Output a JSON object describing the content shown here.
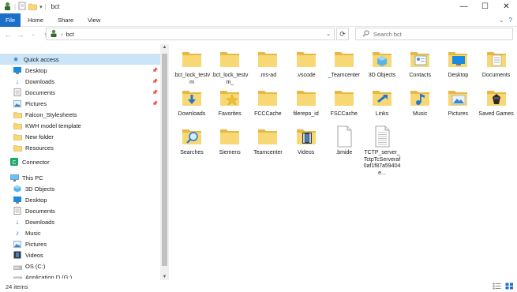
{
  "window": {
    "title": "bct",
    "controls": [
      "—",
      "☐",
      "✕"
    ]
  },
  "ribbon": {
    "tabs": [
      "File",
      "Home",
      "Share",
      "View"
    ]
  },
  "address": {
    "path": "bct"
  },
  "search": {
    "placeholder": "Search bct"
  },
  "sidebar": {
    "items": [
      {
        "label": "Quick access",
        "icon": "star-icon",
        "selected": true
      },
      {
        "label": "Desktop",
        "icon": "desktop-icon",
        "pinned": true
      },
      {
        "label": "Downloads",
        "icon": "downloads-icon",
        "pinned": true
      },
      {
        "label": "Documents",
        "icon": "documents-icon",
        "pinned": true
      },
      {
        "label": "Pictures",
        "icon": "pictures-icon",
        "pinned": true
      },
      {
        "label": "Falcon_Stylesheets",
        "icon": "folder-icon"
      },
      {
        "label": "KWH model template",
        "icon": "folder-icon"
      },
      {
        "label": "New folder",
        "icon": "folder-icon"
      },
      {
        "label": "Resources",
        "icon": "folder-icon"
      },
      {
        "label": "Connector",
        "icon": "connector-icon"
      },
      {
        "label": "This PC",
        "icon": "computer-icon"
      },
      {
        "label": "3D Objects",
        "icon": "3d-objects-icon"
      },
      {
        "label": "Desktop",
        "icon": "desktop-icon"
      },
      {
        "label": "Documents",
        "icon": "documents-icon"
      },
      {
        "label": "Downloads",
        "icon": "downloads-icon"
      },
      {
        "label": "Music",
        "icon": "music-icon"
      },
      {
        "label": "Pictures",
        "icon": "pictures-icon"
      },
      {
        "label": "Videos",
        "icon": "videos-icon"
      },
      {
        "label": "OS  (C:)",
        "icon": "drive-icon"
      },
      {
        "label": "Application D (G:)",
        "icon": "drive-icon"
      }
    ]
  },
  "files": [
    {
      "name": ".bct_lock_testvm",
      "icon": "folder"
    },
    {
      "name": ".bct_lock_testvm_",
      "icon": "folder"
    },
    {
      "name": ".ms-ad",
      "icon": "folder"
    },
    {
      "name": ".vscode",
      "icon": "folder"
    },
    {
      "name": "_Teamcenter",
      "icon": "folder"
    },
    {
      "name": "3D Objects",
      "icon": "folder-3d"
    },
    {
      "name": "Contacts",
      "icon": "folder-contacts"
    },
    {
      "name": "Desktop",
      "icon": "folder-desktop"
    },
    {
      "name": "Documents",
      "icon": "folder-documents"
    },
    {
      "name": "Downloads",
      "icon": "folder-downloads"
    },
    {
      "name": "Favorites",
      "icon": "folder-favorites"
    },
    {
      "name": "FCCCache",
      "icon": "folder"
    },
    {
      "name": "filerepo_id",
      "icon": "folder"
    },
    {
      "name": "FSCCache",
      "icon": "folder"
    },
    {
      "name": "Links",
      "icon": "folder-links"
    },
    {
      "name": "Music",
      "icon": "folder-music"
    },
    {
      "name": "Pictures",
      "icon": "folder-pictures"
    },
    {
      "name": "Saved Games",
      "icon": "folder-games"
    },
    {
      "name": "Searches",
      "icon": "folder-searches"
    },
    {
      "name": "Siemens",
      "icon": "folder"
    },
    {
      "name": "Teamcenter",
      "icon": "folder"
    },
    {
      "name": "Videos",
      "icon": "folder-videos"
    },
    {
      "name": ".bmide",
      "icon": "file"
    },
    {
      "name": "TCTP_server_TctpTcServeraf0af1f87a59404e...",
      "icon": "file-text"
    }
  ],
  "status": {
    "count": "24 items"
  },
  "colors": {
    "accent": "#1a6fc9",
    "folder": "#f8d775",
    "folder_dark": "#e8b844",
    "selection": "#cce4f7"
  }
}
